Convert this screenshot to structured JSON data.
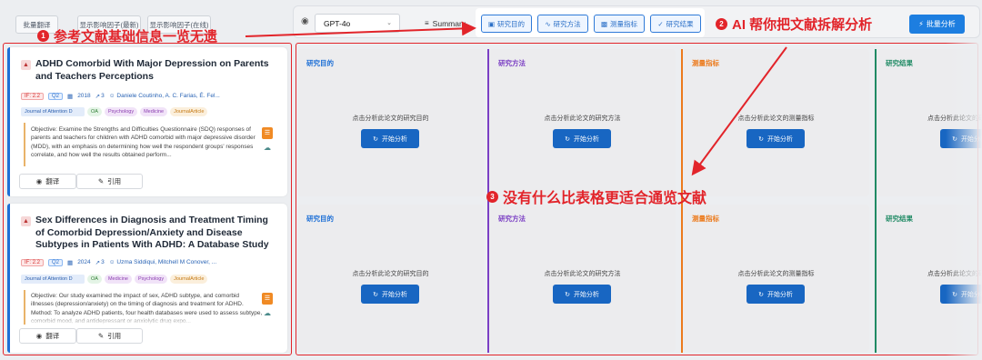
{
  "left_toolbar": {
    "batch_translate": "批量翻译",
    "show_if_latest": "显示影响因子(最新)",
    "show_if_online": "显示影响因子(在线)"
  },
  "right_toolbar": {
    "model": "GPT-4o",
    "summary": "Summary",
    "tabs": [
      "研究目的",
      "研究方法",
      "测量指标",
      "研究结果"
    ],
    "batch_analyze": "批量分析"
  },
  "annotations": {
    "a1_num": "1",
    "a1_text": "参考文献基础信息一览无遗",
    "a2_num": "2",
    "a2_text": "AI 帮你把文献拆解分析",
    "a3_num": "3",
    "a3_text": "没有什么比表格更适合通览文献"
  },
  "papers": [
    {
      "title": "ADHD Comorbid With Major Depression on Parents and Teachers Perceptions",
      "if": "IF: 2.2",
      "q": "Q2",
      "year": "2018",
      "cites": "3",
      "authors": "Daniele Coutinho, A. C. Farias, É. Fel...",
      "tags": [
        "Journal of Attention D",
        "OA",
        "Psychology",
        "Medicine",
        "JournalArticle"
      ],
      "abstract": "Objective: Examine the Strengths and Difficulties Questionnaire (SDQ) responses of parents and teachers for children with ADHD comorbid with major depressive disorder (MDD), with an emphasis on determining how well the respondent groups' responses correlate, and how well the results obtained perform...",
      "translate": "翻译",
      "cite": "引用"
    },
    {
      "title": "Sex Differences in Diagnosis and Treatment Timing of Comorbid Depression/Anxiety and Disease Subtypes in Patients With ADHD: A Database Study",
      "if": "IF: 2.2",
      "q": "Q2",
      "year": "2024",
      "cites": "3",
      "authors": "Uzma Siddiqui, Mitchell M Conover, ...",
      "tags": [
        "Journal of Attention D",
        "OA",
        "Medicine",
        "Psychology",
        "JournalArticle"
      ],
      "abstract": "Objective: Our study examined the impact of sex, ADHD subtype, and comorbid illnesses (depression/anxiety) on the timing of diagnosis and treatment for ADHD. Method: To analyze ADHD patients, four health databases were used to assess subtype, comorbid mood, and antidepressant or anxiolytic drug expo...",
      "translate": "翻译",
      "cite": "引用"
    }
  ],
  "grid": {
    "headers": [
      "研究目的",
      "研究方法",
      "测量指标",
      "研究结果"
    ],
    "hints": [
      "点击分析此论文的研究目的",
      "点击分析此论文的研究方法",
      "点击分析此论文的测量指标",
      "点击分析此论文的研究结果"
    ],
    "button": "开始分析",
    "colors": [
      "#1d6fd6",
      "#7b3fc4",
      "#ec7a1c",
      "#1f8a64"
    ]
  }
}
